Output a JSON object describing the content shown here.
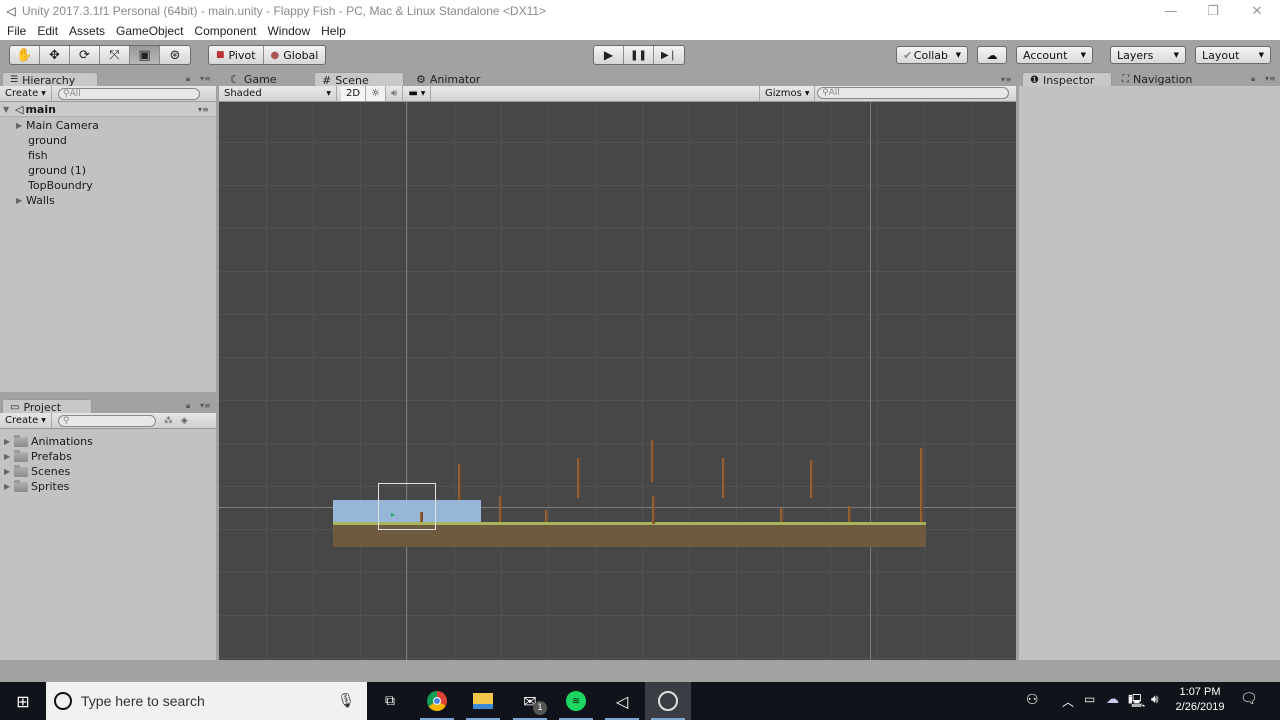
{
  "window": {
    "title": "Unity 2017.3.1f1 Personal (64bit) - main.unity - Flappy Fish - PC, Mac & Linux Standalone <DX11>",
    "controls": {
      "minimize": "—",
      "restore": "❐",
      "close": "✕"
    }
  },
  "menubar": [
    "File",
    "Edit",
    "Assets",
    "GameObject",
    "Component",
    "Window",
    "Help"
  ],
  "toolbar": {
    "tools": [
      {
        "name": "hand-tool",
        "glyph": "✋",
        "active": false
      },
      {
        "name": "move-tool",
        "glyph": "✥",
        "active": false
      },
      {
        "name": "rotate-tool",
        "glyph": "⟳",
        "active": false
      },
      {
        "name": "scale-tool",
        "glyph": "⤧",
        "active": false
      },
      {
        "name": "rect-tool",
        "glyph": "▣",
        "active": true
      },
      {
        "name": "transform-tool",
        "glyph": "⊛",
        "active": false
      }
    ],
    "pivot_label": "Pivot",
    "global_label": "Global",
    "play": "▶",
    "pause": "❚❚",
    "step": "▶❘",
    "collab_label": "Collab",
    "cloud_glyph": "☁",
    "account_label": "Account",
    "layers_label": "Layers",
    "layout_label": "Layout",
    "caret": "▼"
  },
  "hierarchy": {
    "tab_label": "Hierarchy",
    "create_label": "Create",
    "search_placeholder": "All",
    "scene_name": "main",
    "items": [
      {
        "label": "Main Camera",
        "expandable": true
      },
      {
        "label": "ground",
        "expandable": false
      },
      {
        "label": "fish",
        "expandable": false
      },
      {
        "label": "ground (1)",
        "expandable": false
      },
      {
        "label": "TopBoundry",
        "expandable": false
      },
      {
        "label": "Walls",
        "expandable": true
      }
    ]
  },
  "project": {
    "tab_label": "Project",
    "create_label": "Create",
    "search_placeholder": "",
    "folders": [
      "Animations",
      "Prefabs",
      "Scenes",
      "Sprites"
    ]
  },
  "center_tabs": {
    "tabs": [
      {
        "label": "Game",
        "glyph": "☾",
        "active": false
      },
      {
        "label": "Scene",
        "glyph": "#",
        "active": true
      },
      {
        "label": "Animator",
        "glyph": "⚙",
        "active": false
      }
    ],
    "shading_mode": "Shaded",
    "mode_2d": "2D",
    "gizmos_label": "Gizmos",
    "search_placeholder": "All"
  },
  "right_tabs": {
    "inspector_label": "Inspector",
    "navigation_label": "Navigation"
  },
  "taskbar": {
    "search_placeholder": "Type here to search",
    "apps": [
      "task-view",
      "chrome",
      "file-explorer",
      "mail",
      "spotify",
      "unity",
      "obs"
    ],
    "mail_badge": "1",
    "time": "1:07 PM",
    "date": "2/26/2019"
  },
  "colors": {
    "scene_bg": "#474747",
    "ground": "#6e5a3e",
    "water": "#98b7d8",
    "pole": "#8a5a32",
    "grass_line": "#a9b45a"
  }
}
